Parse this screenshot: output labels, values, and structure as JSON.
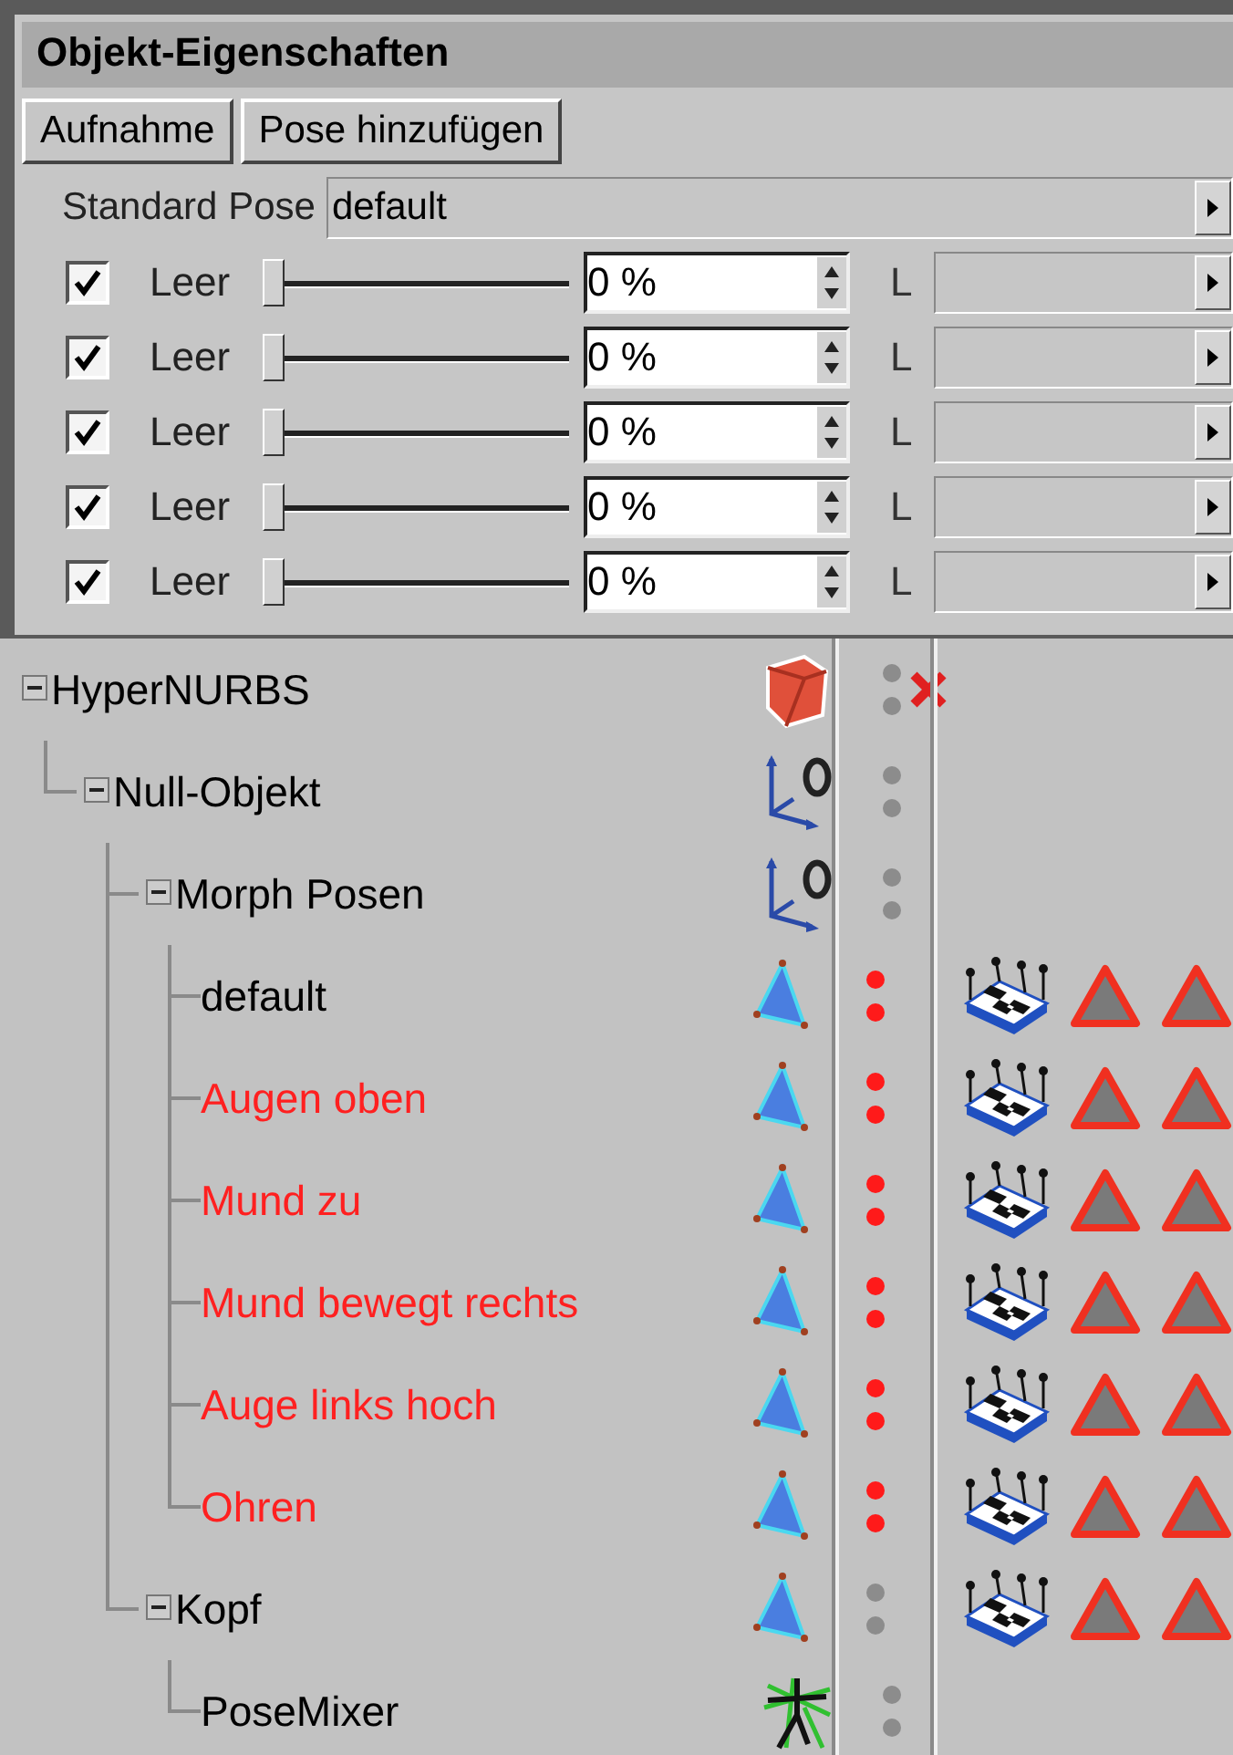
{
  "panel": {
    "title": "Objekt-Eigenschaften",
    "buttons": [
      "Aufnahme",
      "Pose hinzufügen"
    ],
    "standard_pose": {
      "label": "Standard Pose",
      "value": "default"
    },
    "poses": [
      {
        "checked": true,
        "label": "Leer",
        "level": 0,
        "value": "0 %",
        "link_label": "L"
      },
      {
        "checked": true,
        "label": "Leer",
        "level": 0,
        "value": "0 %",
        "link_label": "L"
      },
      {
        "checked": true,
        "label": "Leer",
        "level": 0,
        "value": "0 %",
        "link_label": "L"
      },
      {
        "checked": true,
        "label": "Leer",
        "level": 0,
        "value": "0 %",
        "link_label": "L"
      },
      {
        "checked": true,
        "label": "Leer",
        "level": 0,
        "value": "0 %",
        "link_label": "L"
      }
    ]
  },
  "tree": [
    {
      "name": "HyperNURBS",
      "color": "#000000",
      "kind": "cube",
      "active": false,
      "enabled": false,
      "expanded": true,
      "children": [
        {
          "name": "Null-Objekt",
          "color": "#000000",
          "kind": "null",
          "active": false,
          "expanded": true,
          "children": [
            {
              "name": "Morph Posen",
              "color": "#000000",
              "kind": "null",
              "active": false,
              "expanded": true,
              "children": [
                {
                  "name": "default",
                  "color": "#000000",
                  "kind": "polygon",
                  "active": true,
                  "tags": [
                    {
                      "kind": "morph"
                    },
                    {
                      "kind": "pose"
                    },
                    {
                      "kind": "pose"
                    }
                  ]
                },
                {
                  "name": "Augen oben",
                  "color": "#ff2020",
                  "kind": "polygon",
                  "active": true,
                  "tags": [
                    {
                      "kind": "morph"
                    },
                    {
                      "kind": "pose"
                    },
                    {
                      "kind": "pose"
                    }
                  ]
                },
                {
                  "name": "Mund zu",
                  "color": "#ff2020",
                  "kind": "polygon",
                  "active": true,
                  "tags": [
                    {
                      "kind": "morph"
                    },
                    {
                      "kind": "pose"
                    },
                    {
                      "kind": "pose"
                    }
                  ]
                },
                {
                  "name": "Mund bewegt rechts",
                  "color": "#ff2020",
                  "kind": "polygon",
                  "active": true,
                  "tags": [
                    {
                      "kind": "morph"
                    },
                    {
                      "kind": "pose"
                    },
                    {
                      "kind": "pose"
                    }
                  ]
                },
                {
                  "name": "Auge links hoch",
                  "color": "#ff2020",
                  "kind": "polygon",
                  "active": true,
                  "tags": [
                    {
                      "kind": "morph"
                    },
                    {
                      "kind": "pose"
                    },
                    {
                      "kind": "pose"
                    }
                  ]
                },
                {
                  "name": "Ohren",
                  "color": "#ff2020",
                  "kind": "polygon",
                  "active": true,
                  "tags": [
                    {
                      "kind": "morph"
                    },
                    {
                      "kind": "pose"
                    },
                    {
                      "kind": "pose"
                    }
                  ]
                }
              ]
            },
            {
              "name": "Kopf",
              "color": "#000000",
              "kind": "polygon",
              "active": false,
              "expanded": true,
              "tags": [
                {
                  "kind": "morph"
                },
                {
                  "kind": "pose"
                },
                {
                  "kind": "pose"
                }
              ],
              "children": [
                {
                  "name": "PoseMixer",
                  "color": "#000000",
                  "kind": "posemixer",
                  "active": false
                }
              ]
            }
          ]
        }
      ]
    }
  ]
}
